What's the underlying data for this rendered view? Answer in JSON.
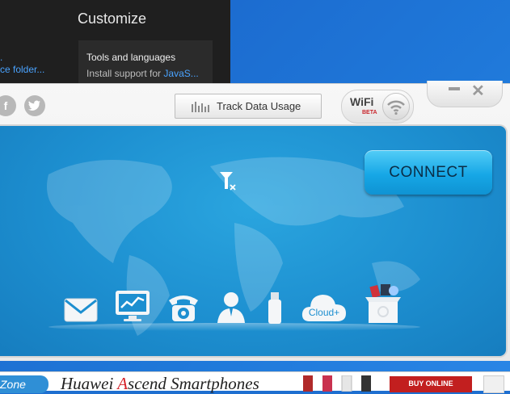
{
  "background": {
    "customize_title": "Customize",
    "tools": {
      "title": "Tools and languages",
      "desc_prefix": "Install support for ",
      "desc_link": "JavaS..."
    },
    "left_link_dot": ".",
    "left_link": "ce folder..."
  },
  "app": {
    "social": {
      "facebook": "f",
      "twitter": "t"
    },
    "track_label": "Track Data Usage",
    "wifi": {
      "label": "WiFi",
      "beta": "BETA"
    },
    "window": {
      "close": "✕"
    },
    "connect_label": "CONNECT",
    "dock": [
      {
        "name": "messages",
        "label": ""
      },
      {
        "name": "statistics",
        "label": ""
      },
      {
        "name": "phone",
        "label": ""
      },
      {
        "name": "contacts",
        "label": ""
      },
      {
        "name": "usb",
        "label": ""
      },
      {
        "name": "cloud",
        "label": "Cloud+"
      },
      {
        "name": "app-store",
        "label": ""
      }
    ]
  },
  "banner": {
    "zone_tab": "Zone",
    "ad_prefix": "Huawei ",
    "ad_red": "A",
    "ad_rest": "scend Smartphones",
    "buy_label": "BUY ONLINE"
  },
  "colors": {
    "accent": "#1d8fd0",
    "connect": "#16a7e6",
    "brand_red": "#d52128"
  }
}
